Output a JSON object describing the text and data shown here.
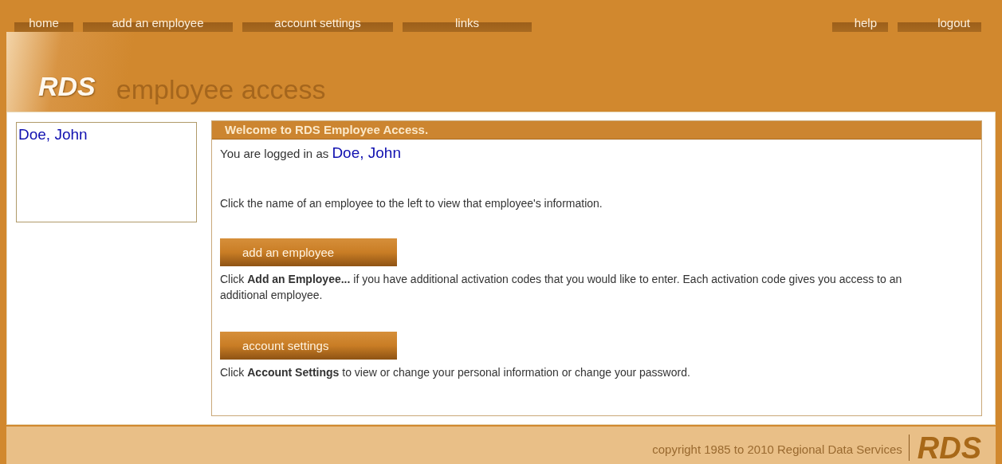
{
  "nav": {
    "left": [
      "home",
      "add an employee",
      "account settings",
      "links"
    ],
    "right": [
      "help",
      "logout"
    ]
  },
  "header": {
    "logo": "RDS",
    "title": "employee access"
  },
  "sidebar": {
    "employees": [
      {
        "name": "Doe, John"
      }
    ]
  },
  "welcome": {
    "title": "Welcome to RDS Employee Access.",
    "logged_in_prefix": "You are logged in as",
    "user": "Doe, John",
    "instructions": "Click the name of an employee to the left to view that employee's information.",
    "actions": [
      {
        "button": "add an employee",
        "description": "Click **Add an Employee...** if you have additional activation codes that you would like to enter. Each activation code gives you access to an additional employee."
      },
      {
        "button": "account settings",
        "description": "Click **Account Settings** to view or change your personal information or change your password."
      }
    ]
  },
  "footer": {
    "copyright": "copyright 1985 to 2010 Regional Data Services",
    "logo": "RDS"
  }
}
